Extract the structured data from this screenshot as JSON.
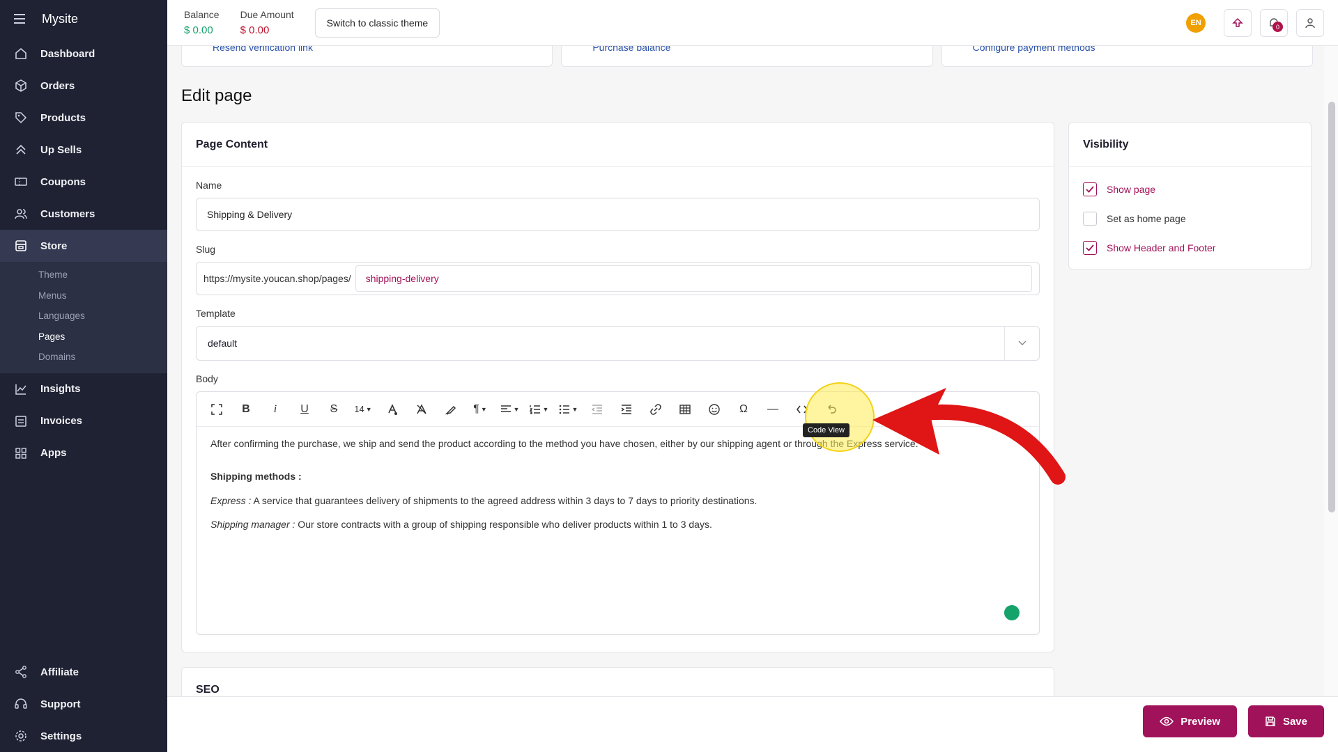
{
  "app": {
    "name": "Mysite"
  },
  "sidebar": {
    "items": [
      {
        "label": "Dashboard",
        "icon": "home-icon"
      },
      {
        "label": "Orders",
        "icon": "box-icon"
      },
      {
        "label": "Products",
        "icon": "tag-icon"
      },
      {
        "label": "Up Sells",
        "icon": "chevrons-up-icon"
      },
      {
        "label": "Coupons",
        "icon": "ticket-icon"
      },
      {
        "label": "Customers",
        "icon": "users-icon"
      }
    ],
    "store": {
      "label": "Store",
      "sub": [
        "Theme",
        "Menus",
        "Languages",
        "Pages",
        "Domains"
      ],
      "active_sub": "Pages"
    },
    "items2": [
      {
        "label": "Insights",
        "icon": "chart-icon"
      },
      {
        "label": "Invoices",
        "icon": "invoice-icon"
      },
      {
        "label": "Apps",
        "icon": "grid-icon"
      }
    ],
    "bottom": [
      {
        "label": "Affiliate",
        "icon": "share-icon"
      },
      {
        "label": "Support",
        "icon": "headset-icon"
      },
      {
        "label": "Settings",
        "icon": "gear-icon"
      }
    ]
  },
  "topbar": {
    "balance_label": "Balance",
    "balance_value": "$ 0.00",
    "due_label": "Due Amount",
    "due_value": "$ 0.00",
    "switch_label": "Switch to classic theme",
    "lang": "EN",
    "notif_count": "0"
  },
  "alerts": [
    "Resend verification link",
    "Purchase balance",
    "Configure payment methods"
  ],
  "page_title": "Edit page",
  "content": {
    "heading": "Page Content",
    "name_label": "Name",
    "name_value": "Shipping & Delivery",
    "slug_label": "Slug",
    "slug_prefix": "https://mysite.youcan.shop/pages/",
    "slug_value": "shipping-delivery",
    "template_label": "Template",
    "template_value": "default",
    "body_label": "Body",
    "font_size": "14",
    "tooltip": "Code View",
    "body": {
      "p1": "After confirming the purchase, we ship and send the product according to the method you have chosen, either by our shipping agent or through the Express service.",
      "h": "Shipping methods :",
      "p2_em": "Express :",
      "p2": " A service that guarantees delivery of shipments to the agreed address within 3 days to 7 days to priority destinations.",
      "p3_em": "Shipping manager :",
      "p3": " Our store contracts with a group of shipping responsible who deliver products within 1 to 3 days."
    }
  },
  "seo": {
    "heading": "SEO"
  },
  "visibility": {
    "heading": "Visibility",
    "items": [
      {
        "label": "Show page",
        "checked": true
      },
      {
        "label": "Set as home page",
        "checked": false
      },
      {
        "label": "Show Header and Footer",
        "checked": true
      }
    ]
  },
  "actions": {
    "preview": "Preview",
    "save": "Save"
  },
  "colors": {
    "accent": "#a0125a",
    "sidebar_bg": "#1f2233",
    "green": "#15a36b",
    "red": "#c0152f"
  }
}
